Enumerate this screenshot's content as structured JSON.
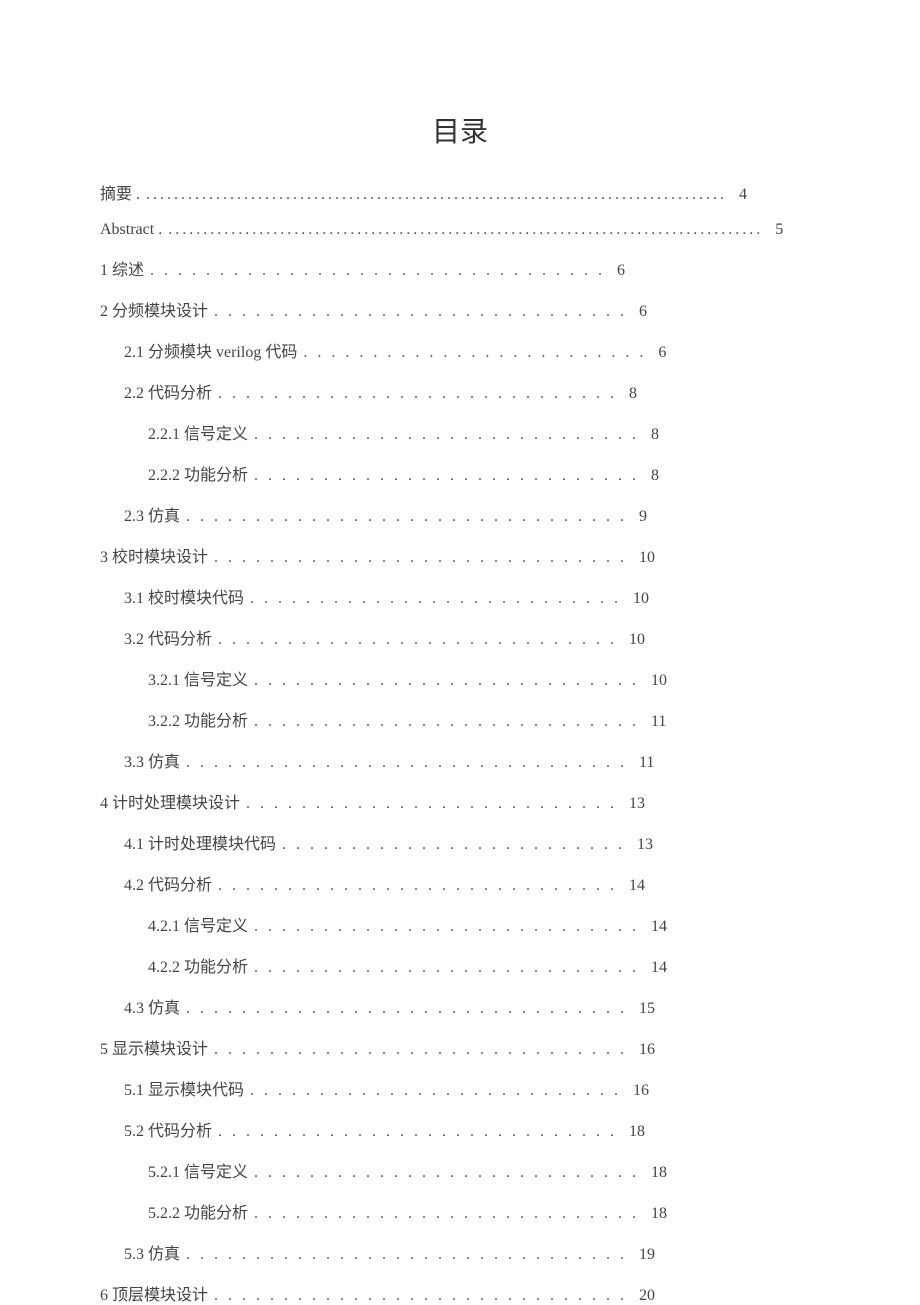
{
  "title": "目录",
  "entries": [
    {
      "label": "摘要 .",
      "page": "4",
      "indent": 0,
      "dots": "..................................................................................."
    },
    {
      "label": "Abstract .",
      "page": "5",
      "indent": 0,
      "dots": "....................................................................................."
    },
    {
      "label": "1  综述",
      "page": "6",
      "indent": 0,
      "dots": ". . . . . . . . . . . . . . . . . . . . . . . . . . . . . . . . ."
    },
    {
      "label": "2  分频模块设计",
      "page": "6",
      "indent": 0,
      "dots": ". . . . . . . . . . . . . . . . . . . . . . . . . . . . . ."
    },
    {
      "label": "2.1  分频模块  verilog 代码",
      "page": "6",
      "indent": 1,
      "dots": ". . . . . . . . . . . . . . . . . . . . . . . . ."
    },
    {
      "label": "2.2  代码分析",
      "page": "8",
      "indent": 1,
      "dots": ". . . . . . . . . . . . . . . . . . . . . . . . . . . . ."
    },
    {
      "label": "2.2.1  信号定义",
      "page": "8",
      "indent": 2,
      "dots": ". . . . . . . . . . . . . . . . . . . . . . . . . . . ."
    },
    {
      "label": "2.2.2  功能分析",
      "page": "8",
      "indent": 2,
      "dots": ". . . . . . . . . . . . . . . . . . . . . . . . . . . ."
    },
    {
      "label": "2.3  仿真",
      "page": "9",
      "indent": 1,
      "dots": ". . . . . . . . . . . . . . . . . . . . . . . . . . . . . . . ."
    },
    {
      "label": "3  校时模块设计",
      "page": "10",
      "indent": 0,
      "dots": ". . . . . . . . . . . . . . . . . . . . . . . . . . . . . ."
    },
    {
      "label": "3.1  校时模块代码",
      "page": "10",
      "indent": 1,
      "dots": ". . . . . . . . . . . . . . . . . . . . . . . . . . ."
    },
    {
      "label": "3.2  代码分析",
      "page": "10",
      "indent": 1,
      "dots": ". . . . . . . . . . . . . . . . . . . . . . . . . . . . ."
    },
    {
      "label": "3.2.1  信号定义",
      "page": "10",
      "indent": 2,
      "dots": ". . . . . . . . . . . . . . . . . . . . . . . . . . . ."
    },
    {
      "label": "3.2.2  功能分析",
      "page": "11",
      "indent": 2,
      "dots": ". . . . . . . . . . . . . . . . . . . . . . . . . . . ."
    },
    {
      "label": "3.3  仿真",
      "page": "11",
      "indent": 1,
      "dots": ". . . . . . . . . . . . . . . . . . . . . . . . . . . . . . . ."
    },
    {
      "label": "4  计时处理模块设计",
      "page": "13",
      "indent": 0,
      "dots": ". . . . . . . . . . . . . . . . . . . . . . . . . . ."
    },
    {
      "label": "4.1  计时处理模块代码",
      "page": "13",
      "indent": 1,
      "dots": ". . . . . . . . . . . . . . . . . . . . . . . . ."
    },
    {
      "label": "4.2  代码分析",
      "page": "14",
      "indent": 1,
      "dots": ". . . . . . . . . . . . . . . . . . . . . . . . . . . . ."
    },
    {
      "label": "4.2.1  信号定义",
      "page": "14",
      "indent": 2,
      "dots": ". . . . . . . . . . . . . . . . . . . . . . . . . . . ."
    },
    {
      "label": "4.2.2  功能分析",
      "page": "14",
      "indent": 2,
      "dots": ". . . . . . . . . . . . . . . . . . . . . . . . . . . ."
    },
    {
      "label": "4.3  仿真",
      "page": "15",
      "indent": 1,
      "dots": ". . . . . . . . . . . . . . . . . . . . . . . . . . . . . . . ."
    },
    {
      "label": "5  显示模块设计",
      "page": "16",
      "indent": 0,
      "dots": ". . . . . . . . . . . . . . . . . . . . . . . . . . . . . ."
    },
    {
      "label": "5.1  显示模块代码",
      "page": "16",
      "indent": 1,
      "dots": ". . . . . . . . . . . . . . . . . . . . . . . . . . ."
    },
    {
      "label": "5.2  代码分析",
      "page": "18",
      "indent": 1,
      "dots": ". . . . . . . . . . . . . . . . . . . . . . . . . . . . ."
    },
    {
      "label": "5.2.1  信号定义",
      "page": "18",
      "indent": 2,
      "dots": ". . . . . . . . . . . . . . . . . . . . . . . . . . . ."
    },
    {
      "label": "5.2.2  功能分析",
      "page": "18",
      "indent": 2,
      "dots": ". . . . . . . . . . . . . . . . . . . . . . . . . . . ."
    },
    {
      "label": "5.3  仿真",
      "page": "19",
      "indent": 1,
      "dots": ". . . . . . . . . . . . . . . . . . . . . . . . . . . . . . . ."
    },
    {
      "label": "6  顶层模块设计",
      "page": "20",
      "indent": 0,
      "dots": ". . . . . . . . . . . . . . . . . . . . . . . . . . . . . ."
    }
  ]
}
